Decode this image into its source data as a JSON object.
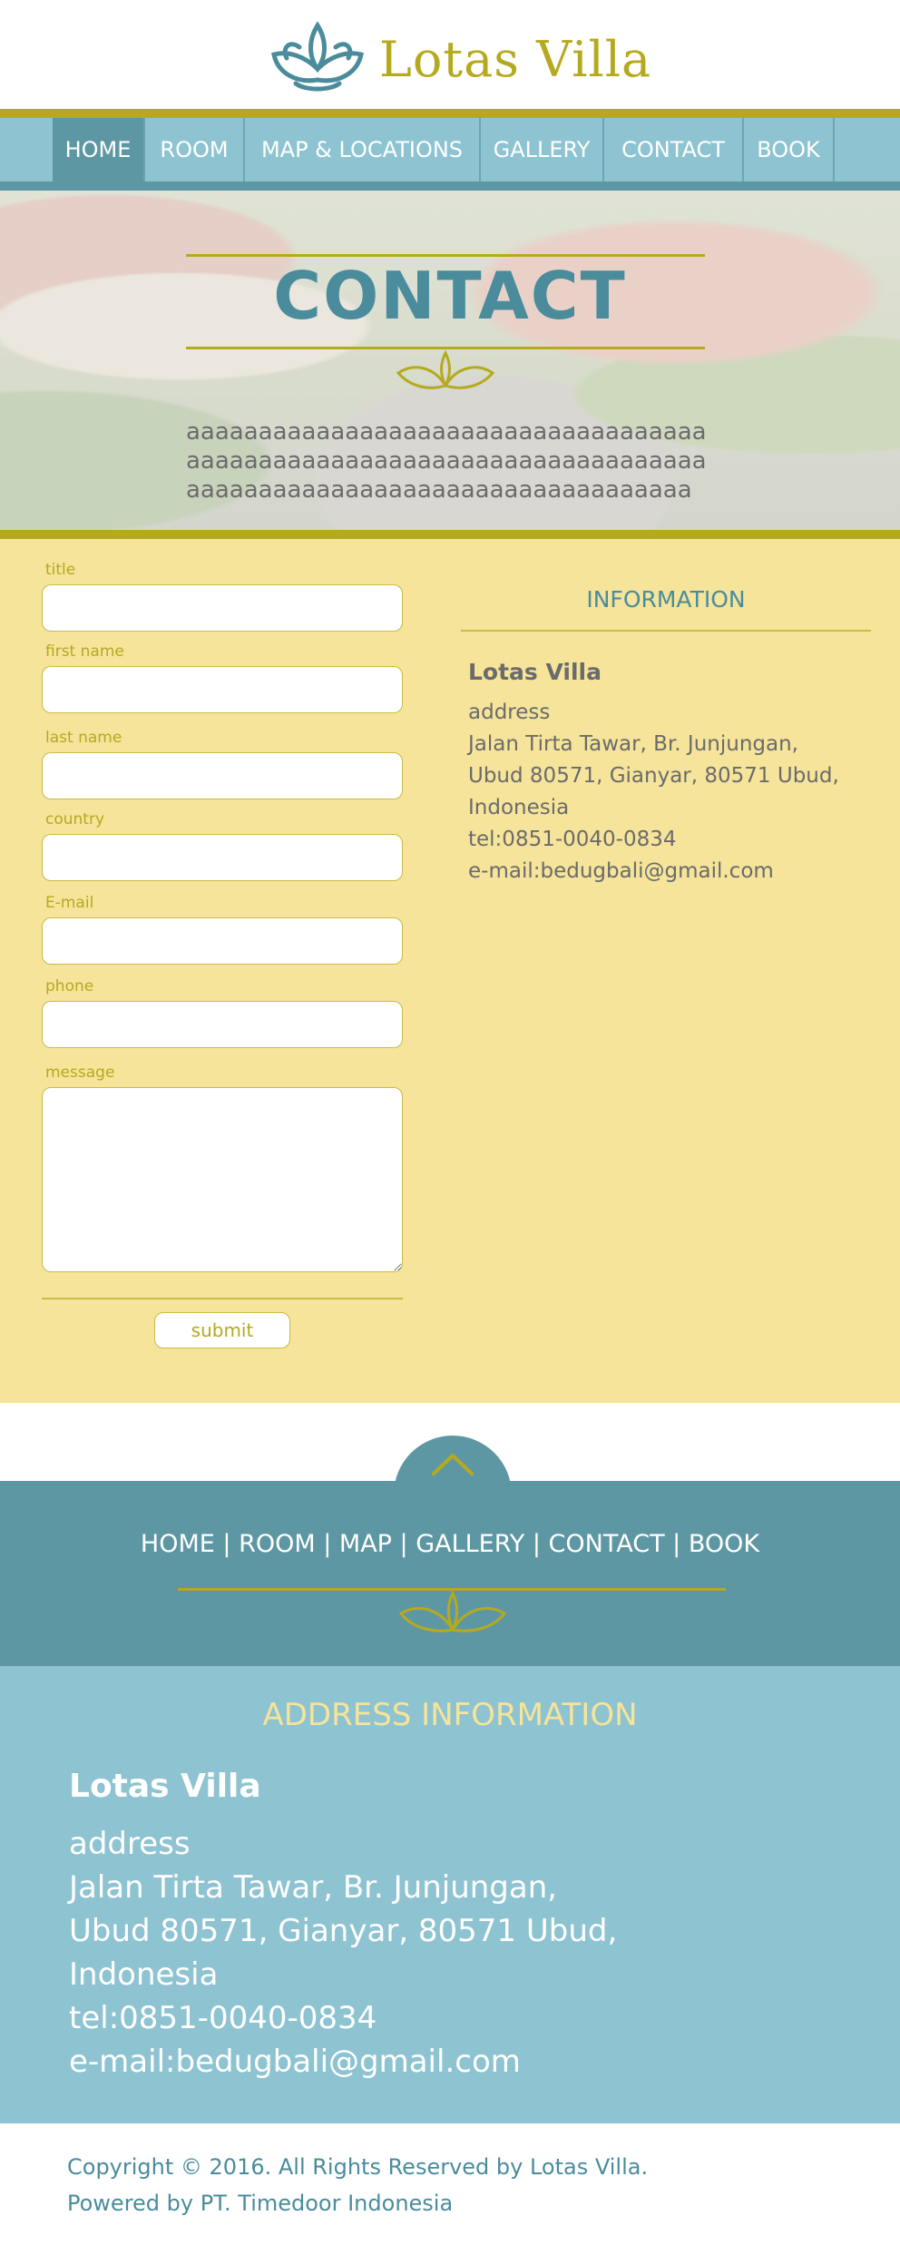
{
  "brand": {
    "name": "Lotas Villa",
    "logo_icon": "lotus-icon"
  },
  "nav": {
    "items": [
      {
        "label": "HOME",
        "active": true
      },
      {
        "label": "ROOM"
      },
      {
        "label": "MAP &  LOCATIONS"
      },
      {
        "label": "GALLERY"
      },
      {
        "label": "CONTACT"
      },
      {
        "label": "BOOK"
      }
    ]
  },
  "hero": {
    "title": "CONTACT",
    "text": "aaaaaaaaaaaaaaaaaaaaaaaaaaaaaaaaaaaaaaaaaaaaaaaaaaaaaaaaaaaaaaaaaaaaaaaaaaaaaaaaaaaaaaaaaaaaaaaaaaaaaaaaaaa",
    "ornament_icon": "flourish-ornament-icon"
  },
  "form": {
    "fields": [
      {
        "label": "title",
        "value": ""
      },
      {
        "label": "first name",
        "value": ""
      },
      {
        "label": "last name",
        "value": ""
      },
      {
        "label": "country",
        "value": ""
      },
      {
        "label": "E-mail",
        "value": ""
      },
      {
        "label": "phone",
        "value": ""
      },
      {
        "label": "message",
        "value": ""
      }
    ],
    "submit_label": "submit"
  },
  "information": {
    "title": "INFORMATION",
    "name": "Lotas Villa",
    "lines": [
      "address",
      "Jalan Tirta Tawar, Br. Junjungan,",
      "Ubud 80571, Gianyar, 80571 Ubud,",
      "Indonesia",
      "tel:0851-0040-0834",
      "e-mail:bedugbali@gmail.com"
    ]
  },
  "footer_nav": {
    "back_to_top_icon": "chevron-up-icon",
    "links_text": "HOME | ROOM | MAP | GALLERY  | CONTACT | BOOK"
  },
  "address_info": {
    "title": "ADDRESS INFORMATION",
    "name": "Lotas Villa",
    "lines": [
      "address",
      "Jalan Tirta Tawar, Br. Junjungan,",
      "Ubud 80571, Gianyar, 80571 Ubud,",
      "Indonesia",
      "tel:0851-0040-0834",
      "e-mail:bedugbali@gmail.com"
    ]
  },
  "copyright": {
    "line1": "Copyright © 2016. All Rights Reserved by Lotas Villa.",
    "line2": "Powered by PT. Timedoor Indonesia"
  },
  "colors": {
    "gold": "#b5aa1f",
    "teal_dark": "#5e97a4",
    "teal_light": "#8ec3d1",
    "cream": "#f5e49a",
    "title_teal": "#4a8c9c"
  }
}
